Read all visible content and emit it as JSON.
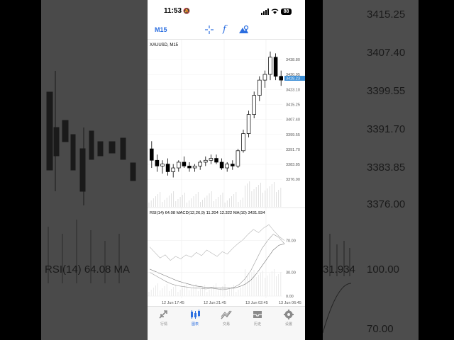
{
  "status_bar": {
    "time": "11:53",
    "battery": "88"
  },
  "toolbar": {
    "timeframe": "M15"
  },
  "chart": {
    "symbol_label": "XAUUSD, M15",
    "price_ticks": [
      "3438.80",
      "3430.95",
      "3423.10",
      "3415.25",
      "3407.40",
      "3399.55",
      "3391.70",
      "3383.85",
      "3376.00"
    ],
    "current_price": "3428.23",
    "indicator_label": "RSI(14) 64.08 MACD(12,26,9) 11.204 12.322 MA(10) 3431.934",
    "indicator_ticks": [
      "70.00",
      "30.00",
      "0.00"
    ],
    "time_labels": [
      "12 Jun 17:45",
      "12 Jun 21:45",
      "13 Jun 02:45",
      "13 Jun 06:45"
    ],
    "price_range": [
      3372.0,
      3444.0
    ],
    "candles": [
      [
        3392,
        3396,
        3382,
        3386
      ],
      [
        3386,
        3389,
        3380,
        3383
      ],
      [
        3383,
        3386,
        3379,
        3384
      ],
      [
        3384,
        3387,
        3378,
        3380
      ],
      [
        3380,
        3384,
        3377,
        3382
      ],
      [
        3382,
        3386,
        3380,
        3385
      ],
      [
        3385,
        3388,
        3382,
        3383
      ],
      [
        3383,
        3385,
        3380,
        3382
      ],
      [
        3382,
        3384,
        3380,
        3383
      ],
      [
        3383,
        3386,
        3381,
        3385
      ],
      [
        3385,
        3388,
        3383,
        3386
      ],
      [
        3386,
        3389,
        3384,
        3387
      ],
      [
        3387,
        3389,
        3384,
        3385
      ],
      [
        3385,
        3387,
        3381,
        3382
      ],
      [
        3382,
        3385,
        3380,
        3384
      ],
      [
        3384,
        3386,
        3381,
        3383
      ],
      [
        3383,
        3392,
        3382,
        3391
      ],
      [
        3391,
        3402,
        3390,
        3400
      ],
      [
        3400,
        3412,
        3398,
        3410
      ],
      [
        3410,
        3422,
        3408,
        3420
      ],
      [
        3420,
        3430,
        3417,
        3428
      ],
      [
        3428,
        3433,
        3424,
        3431
      ],
      [
        3431,
        3443,
        3428,
        3440
      ],
      [
        3440,
        3442,
        3428,
        3430
      ],
      [
        3430,
        3433,
        3425,
        3428
      ]
    ]
  },
  "tabs": [
    {
      "label": "行情",
      "icon": "quotes-icon"
    },
    {
      "label": "图表",
      "icon": "chart-icon"
    },
    {
      "label": "交易",
      "icon": "trade-icon"
    },
    {
      "label": "历史",
      "icon": "history-icon"
    },
    {
      "label": "设置",
      "icon": "settings-icon"
    }
  ],
  "background": {
    "right_prices": [
      "3415.25",
      "3407.40",
      "3399.55",
      "3391.70",
      "3383.85",
      "3376.00"
    ],
    "left_indicator": "RSI(14) 64.08 MA",
    "right_indicator_value": "31.934",
    "right_indicator_ticks": [
      "100.00",
      "70.00"
    ]
  },
  "colors": {
    "accent": "#2b6ee0",
    "candle": "#000000",
    "price_tag": "#3d8fd6"
  }
}
